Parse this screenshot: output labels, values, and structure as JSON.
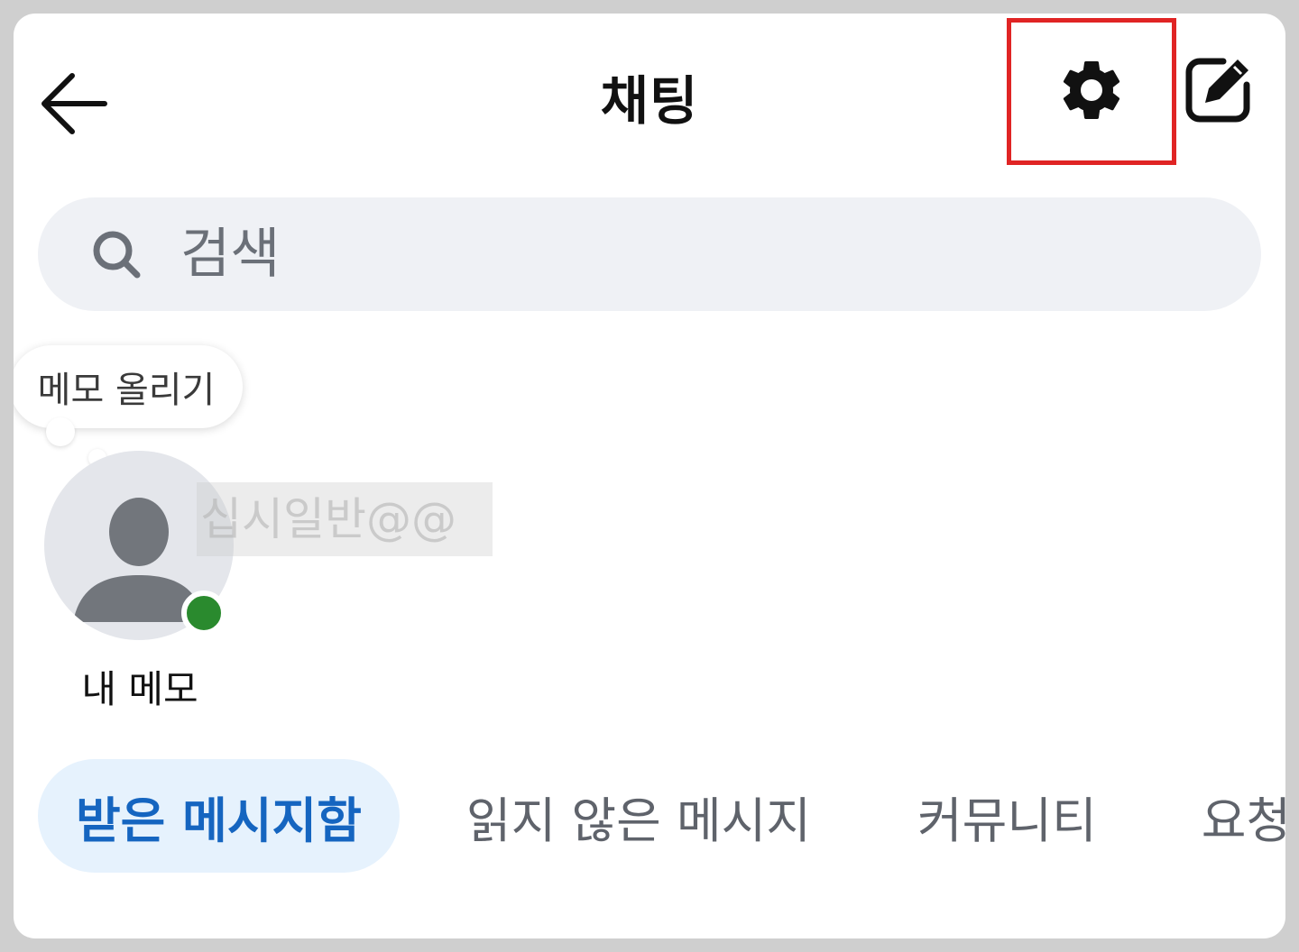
{
  "header": {
    "title": "채팅",
    "back_icon": "arrow-left-icon",
    "settings_icon": "gear-icon",
    "compose_icon": "compose-icon",
    "highlight_color": "#e02424"
  },
  "search": {
    "placeholder": "검색",
    "icon": "search-icon"
  },
  "memo": {
    "bubble_text": "메모 올리기",
    "label": "내 메모",
    "watermark_text": "십시일반@@",
    "online_color": "#2a8a2e"
  },
  "tabs": [
    {
      "label": "받은 메시지함",
      "active": true
    },
    {
      "label": "읽지 않은 메시지",
      "active": false
    },
    {
      "label": "커뮤니티",
      "active": false
    },
    {
      "label": "요청",
      "active": false
    }
  ],
  "colors": {
    "accent": "#1565c0",
    "active_tab_bg": "#e6f2fd",
    "search_bg": "#eff1f5"
  }
}
